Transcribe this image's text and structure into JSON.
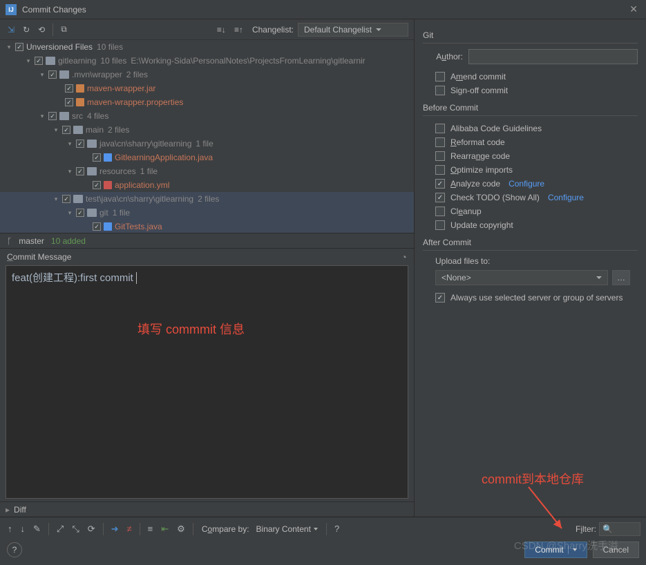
{
  "window": {
    "title": "Commit Changes"
  },
  "toolbar": {
    "changelist_label": "Changelist:",
    "changelist_value": "Default Changelist"
  },
  "tree": {
    "root_label": "Unversioned Files",
    "root_count": "10 files",
    "nodes": [
      {
        "indent": 36,
        "exp": "▾",
        "checked": true,
        "icon": "folder",
        "label": "gitlearning",
        "labelClass": "gray",
        "count": "10 files",
        "path": "E:\\Working-Sida\\PersonalNotes\\ProjectsFromLearning\\gitlearnir"
      },
      {
        "indent": 56,
        "exp": "▾",
        "checked": true,
        "icon": "dotfolder",
        "label": ".mvn\\wrapper",
        "labelClass": "gray",
        "count": "2 files"
      },
      {
        "indent": 80,
        "exp": "",
        "checked": true,
        "icon": "jar",
        "label": "maven-wrapper.jar",
        "labelClass": ""
      },
      {
        "indent": 80,
        "exp": "",
        "checked": true,
        "icon": "props",
        "label": "maven-wrapper.properties",
        "labelClass": ""
      },
      {
        "indent": 56,
        "exp": "▾",
        "checked": true,
        "icon": "folder",
        "label": "src",
        "labelClass": "gray",
        "count": "4 files"
      },
      {
        "indent": 76,
        "exp": "▾",
        "checked": true,
        "icon": "folder",
        "label": "main",
        "labelClass": "gray",
        "count": "2 files"
      },
      {
        "indent": 96,
        "exp": "▾",
        "checked": true,
        "icon": "folder",
        "label": "java\\cn\\sharry\\gitlearning",
        "labelClass": "gray",
        "count": "1 file"
      },
      {
        "indent": 120,
        "exp": "",
        "checked": true,
        "icon": "java",
        "label": "GitlearningApplication.java",
        "labelClass": ""
      },
      {
        "indent": 96,
        "exp": "▾",
        "checked": true,
        "icon": "folder",
        "label": "resources",
        "labelClass": "gray",
        "count": "1 file"
      },
      {
        "indent": 120,
        "exp": "",
        "checked": true,
        "icon": "yml",
        "label": "application.yml",
        "labelClass": ""
      },
      {
        "indent": 76,
        "exp": "▾",
        "checked": true,
        "icon": "folder",
        "label": "test\\java\\cn\\sharry\\gitlearning",
        "labelClass": "gray",
        "count": "2 files",
        "hl": true
      },
      {
        "indent": 96,
        "exp": "▾",
        "checked": true,
        "icon": "folder",
        "label": "git",
        "labelClass": "gray",
        "count": "1 file",
        "hl": true
      },
      {
        "indent": 120,
        "exp": "",
        "checked": true,
        "icon": "java",
        "label": "GitTests.java",
        "labelClass": "",
        "hl": true
      }
    ]
  },
  "branch": {
    "name": "master",
    "added": "10 added"
  },
  "commit_msg": {
    "label": "Commit Message",
    "value": "feat(创建工程):first commit"
  },
  "overlay": {
    "msg_note": "填写 commmit 信息",
    "commit_note": "commit到本地仓库"
  },
  "diff": {
    "label": "Diff",
    "compare_by_label": "Compare by:",
    "compare_by_value": "Binary Content",
    "filter_label": "Filter:"
  },
  "right": {
    "git_title": "Git",
    "author_label": "Author:",
    "amend": "Amend commit",
    "signoff": "Sign-off commit",
    "before_title": "Before Commit",
    "alibaba": "Alibaba Code Guidelines",
    "reformat": "Reformat code",
    "rearrange": "Rearrange code",
    "optimize": "Optimize imports",
    "analyze": "Analyze code",
    "todo": "Check TODO (Show All)",
    "cleanup": "Cleanup",
    "copyright": "Update copyright",
    "configure": "Configure",
    "after_title": "After Commit",
    "upload_label": "Upload files to:",
    "upload_value": "<None>",
    "always_use": "Always use selected server or group of servers"
  },
  "footer": {
    "commit": "Commit",
    "cancel": "Cancel"
  },
  "watermark": "CSDN @Sharry洗手溢"
}
